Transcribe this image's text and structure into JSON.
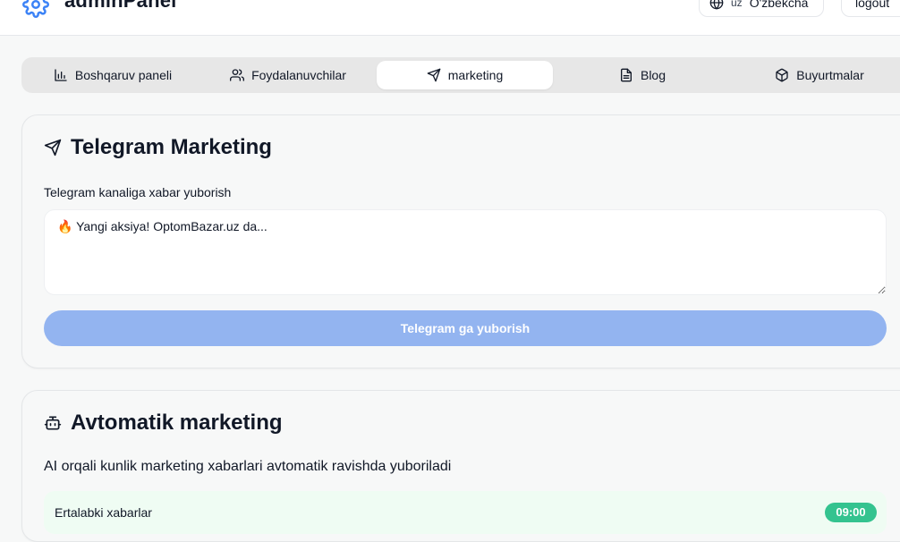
{
  "header": {
    "brand_title": "adminPanel",
    "brand_icon": "gear-icon",
    "language": {
      "code": "uz",
      "name": "O'zbekcha",
      "icon": "globe-icon"
    },
    "logout_label": "logout"
  },
  "tabs": [
    {
      "label": "Boshqaruv paneli",
      "icon": "bar-chart-icon",
      "active": false
    },
    {
      "label": "Foydalanuvchilar",
      "icon": "users-icon",
      "active": false
    },
    {
      "label": "marketing",
      "icon": "send-icon",
      "active": true
    },
    {
      "label": "Blog",
      "icon": "file-text-icon",
      "active": false
    },
    {
      "label": "Buyurtmalar",
      "icon": "package-icon",
      "active": false
    }
  ],
  "telegram_card": {
    "title": "Telegram Marketing",
    "icon": "send-icon",
    "field_label": "Telegram kanaliga xabar yuborish",
    "message_value": "🔥 Yangi aksiya! OptomBazar.uz da...",
    "send_label": "Telegram ga yuborish"
  },
  "auto_card": {
    "title": "Avtomatik marketing",
    "icon": "bot-icon",
    "description": "AI orqali kunlik marketing xabarlari avtomatik ravishda yuboriladi",
    "schedules": [
      {
        "label": "Ertalabki xabarlar",
        "time": "09:00"
      }
    ]
  },
  "colors": {
    "accent_blue": "#3b82f6",
    "button_disabled": "#93b4f0",
    "success": "#34c38f",
    "success_bg": "#effcf3"
  }
}
